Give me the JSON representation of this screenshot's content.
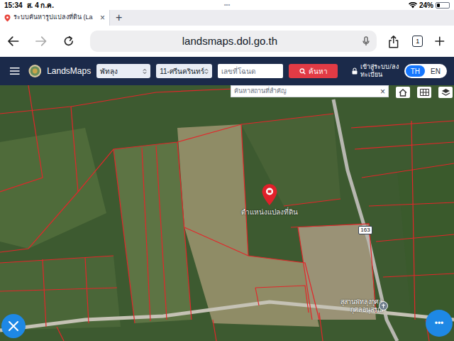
{
  "status_bar": {
    "time": "15:34",
    "date": "ส. 4 ก.ค.",
    "dots": "•••",
    "battery": "24%",
    "battery_level": 0.24
  },
  "browser": {
    "tab": {
      "title": "ระบบค้นหารูปแปลงที่ดิน (La",
      "close": "×",
      "selected": true
    },
    "new_tab": "+",
    "url": "landsmaps.dol.go.th",
    "tab_count": "1"
  },
  "header": {
    "brand": "LandsMaps",
    "province": "พัทลุง",
    "district": "11-ศรีนครินทร์",
    "deed_placeholder": "เลขที่โฉนด",
    "search_button": "ค้นหา",
    "login": [
      "เข้าสู่ระบบ/ลง",
      "ทะเบียน"
    ],
    "languages": [
      {
        "label": "TH",
        "selected": true
      },
      {
        "label": "EN",
        "selected": false
      }
    ]
  },
  "map": {
    "place_search_placeholder": "ค้นหาสถานที่สำคัญ",
    "clear": "×",
    "pin_label": "ตำแหน่งแปลงที่ดิน",
    "road_number": "163",
    "poi_label": [
      "สุสานพัทลุงกุศล",
      "กุศลอนุสรณ์"
    ],
    "fab_more": "•••"
  }
}
